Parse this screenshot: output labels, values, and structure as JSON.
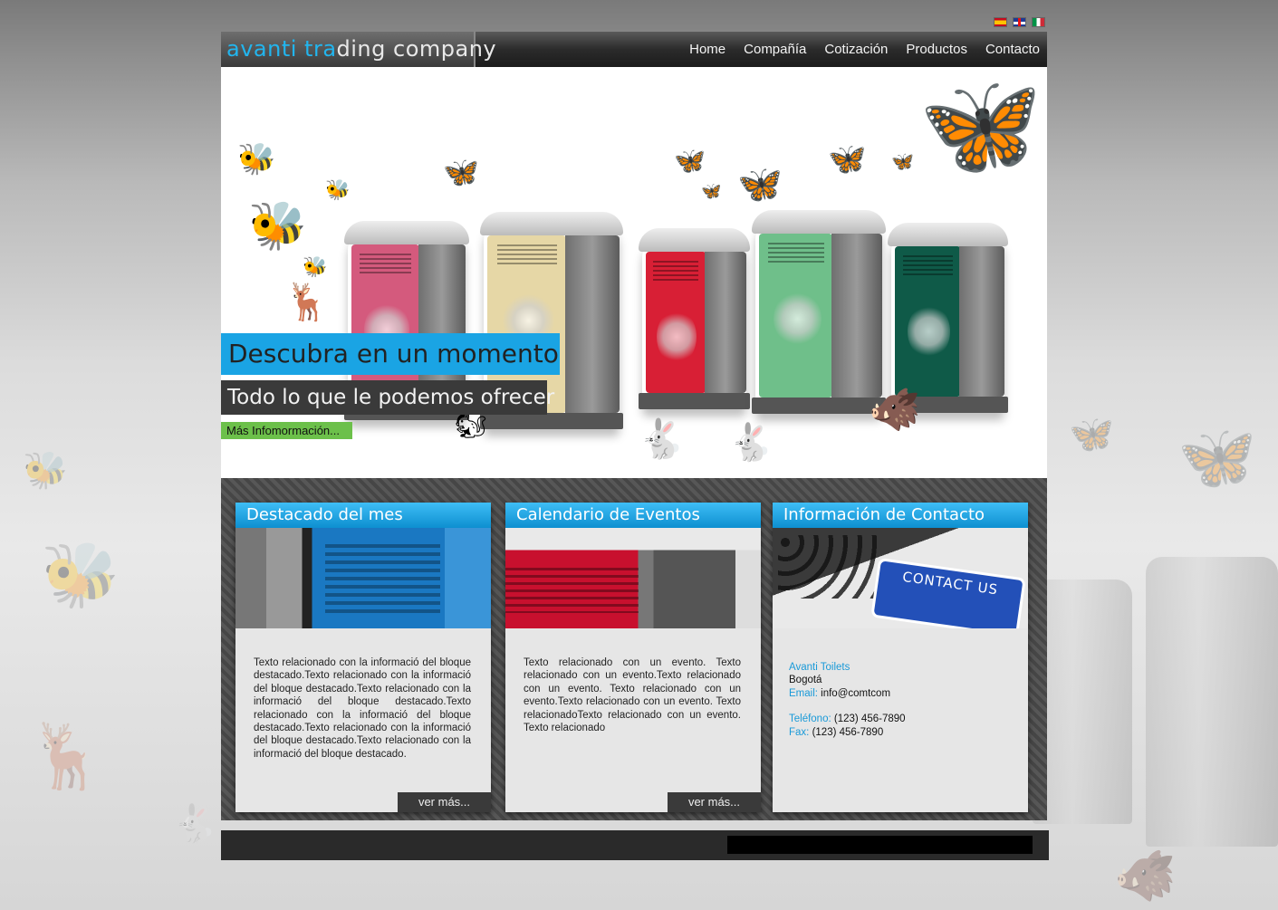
{
  "languages": [
    {
      "code": "es",
      "icon": "spain-flag-icon"
    },
    {
      "code": "en",
      "icon": "uk-flag-icon"
    },
    {
      "code": "it",
      "icon": "italy-flag-icon"
    }
  ],
  "header": {
    "logo_part1": "avanti tra",
    "logo_part2": "ding company",
    "nav": [
      "Home",
      "Compañía",
      "Cotización",
      "Productos",
      "Contacto"
    ]
  },
  "hero": {
    "headline": "Descubra en un momento",
    "subheadline": "Todo lo que le podemos ofrecer",
    "button": "Más Infomormación..."
  },
  "cards": {
    "featured": {
      "title": "Destacado del mes",
      "text": "Texto relacionado con la informació del bloque destacado.Texto relacionado con la informació del bloque destacado.Texto relacionado con la informació del bloque destacado.Texto relacionado con la informació del bloque destacado.Texto relacionado con la informació del bloque destacado.Texto relacionado con la informació del bloque destacado.",
      "more": "ver más..."
    },
    "events": {
      "title": "Calendario de Eventos",
      "text": "Texto relacionado con un evento. Texto relacionado con un evento.Texto relacionado con un evento. Texto relacionado con un evento.Texto relacionado con un evento. Texto relacionadoTexto relacionado con un evento. Texto relacionado",
      "more": "ver más..."
    },
    "contact": {
      "title": "Información de Contacto",
      "image_sign": "CONTACT US",
      "company": "Avanti Toilets",
      "city": "Bogotá",
      "email_label": "Email:",
      "email": "info@comtcom",
      "phone_label": "Teléfono:",
      "phone": "(123) 456-7890",
      "fax_label": "Fax:",
      "fax": "(123) 456-7890"
    }
  },
  "colors": {
    "accent_blue": "#1aa4e4",
    "button_green": "#6cc04a",
    "dark": "#2a2a2a"
  }
}
